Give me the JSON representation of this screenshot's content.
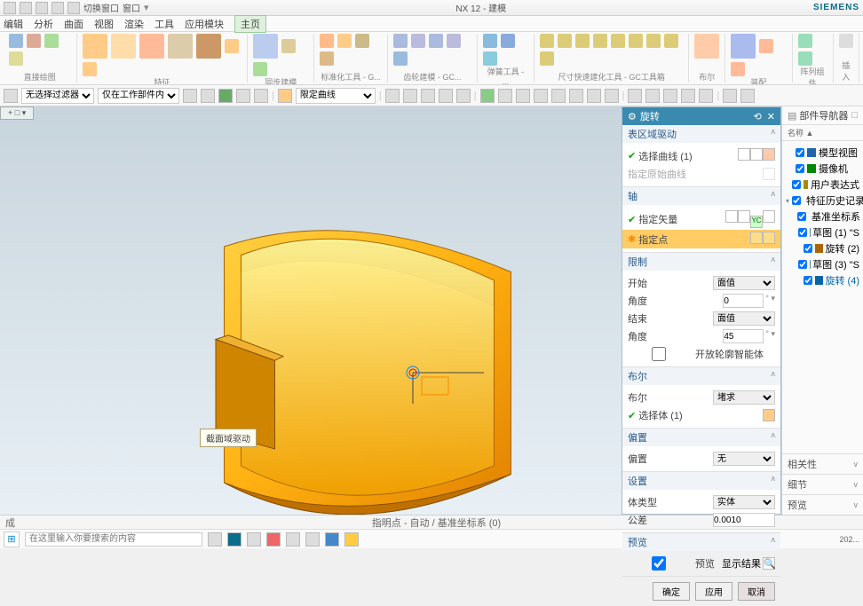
{
  "app": {
    "title_center": "NX 12 - 建模",
    "brand": "SIEMENS"
  },
  "titlebar_menu": [
    "切换窗口",
    "窗口"
  ],
  "menubar": [
    "编辑",
    "分析",
    "曲面",
    "视图",
    "渲染",
    "工具",
    "应用模块",
    "主页"
  ],
  "menubar_active": "主页",
  "ribbon_groups": [
    {
      "label": "直接绘图"
    },
    {
      "label": "特征"
    },
    {
      "label": "同步建模"
    },
    {
      "label": "标准化工具 - G..."
    },
    {
      "label": "齿轮建模 - GC..."
    },
    {
      "label": "弹簧工具 - ..."
    },
    {
      "label": "尺寸快速建化工具 - GC工具箱"
    },
    {
      "label": "布尔"
    },
    {
      "label": "装配"
    },
    {
      "label": "阵列组件"
    },
    {
      "label": "插入"
    }
  ],
  "toolbar": {
    "sel1": "无选择过滤器",
    "sel2": "仅在工作部件内",
    "sel3": "限定曲线"
  },
  "viewport": {
    "tab": "+ □ ▾",
    "tooltip": "截面域驱动"
  },
  "dialog": {
    "title": "旋转",
    "sections": {
      "curve": {
        "title": "表区域驱动",
        "pick": "选择曲线 (1)",
        "hint": "指定原始曲线"
      },
      "axis": {
        "title": "轴",
        "vec": "指定矢量",
        "pt": "指定点"
      },
      "limit": {
        "title": "限制",
        "start": "开始",
        "s_mode": "面值",
        "s_ang": "角度",
        "s_ang_v": "0",
        "end": "结束",
        "e_mode": "面值",
        "e_ang": "角度",
        "e_ang_v": "45",
        "open": "开放轮廓智能体"
      },
      "bool": {
        "title": "布尔",
        "lab": "布尔",
        "val": "堵求",
        "sel": "选择体 (1)"
      },
      "offset": {
        "title": "偏置",
        "lab": "偏置",
        "val": "无"
      },
      "settings": {
        "title": "设置",
        "lab1": "体类型",
        "val1": "实体",
        "lab2": "公差",
        "val2": "0.0010"
      },
      "preview": {
        "title": "预览",
        "lab": "预览",
        "res": "显示结果"
      }
    },
    "buttons": {
      "ok": "确定",
      "apply": "应用",
      "cancel": "取消"
    }
  },
  "right_pane": {
    "title": "部件导航器",
    "header": "名称 ▲",
    "tree": [
      {
        "t": "模型视图",
        "ind": 0,
        "c": "#26a"
      },
      {
        "t": "摄像机",
        "ind": 0,
        "c": "#080"
      },
      {
        "t": "用户表达式",
        "ind": 0,
        "c": "#a80"
      },
      {
        "t": "特征历史记录",
        "ind": 0,
        "c": "#a80",
        "exp": true
      },
      {
        "t": "基准坐标系",
        "ind": 1,
        "c": "#588"
      },
      {
        "t": "草图 (1) \"S",
        "ind": 1,
        "c": "#588"
      },
      {
        "t": "旋转 (2)",
        "ind": 1,
        "c": "#a60"
      },
      {
        "t": "草图 (3) \"S",
        "ind": 1,
        "c": "#588"
      },
      {
        "t": "旋转 (4)",
        "ind": 1,
        "c": "#06a",
        "sel": true
      }
    ],
    "accordions": [
      "相关性",
      "细节",
      "预览"
    ]
  },
  "status": {
    "left": "成",
    "center": "指明点 - 自动 / 基准坐标系 (0)"
  },
  "search": {
    "placeholder": "在这里输入你要搜索的内容"
  }
}
